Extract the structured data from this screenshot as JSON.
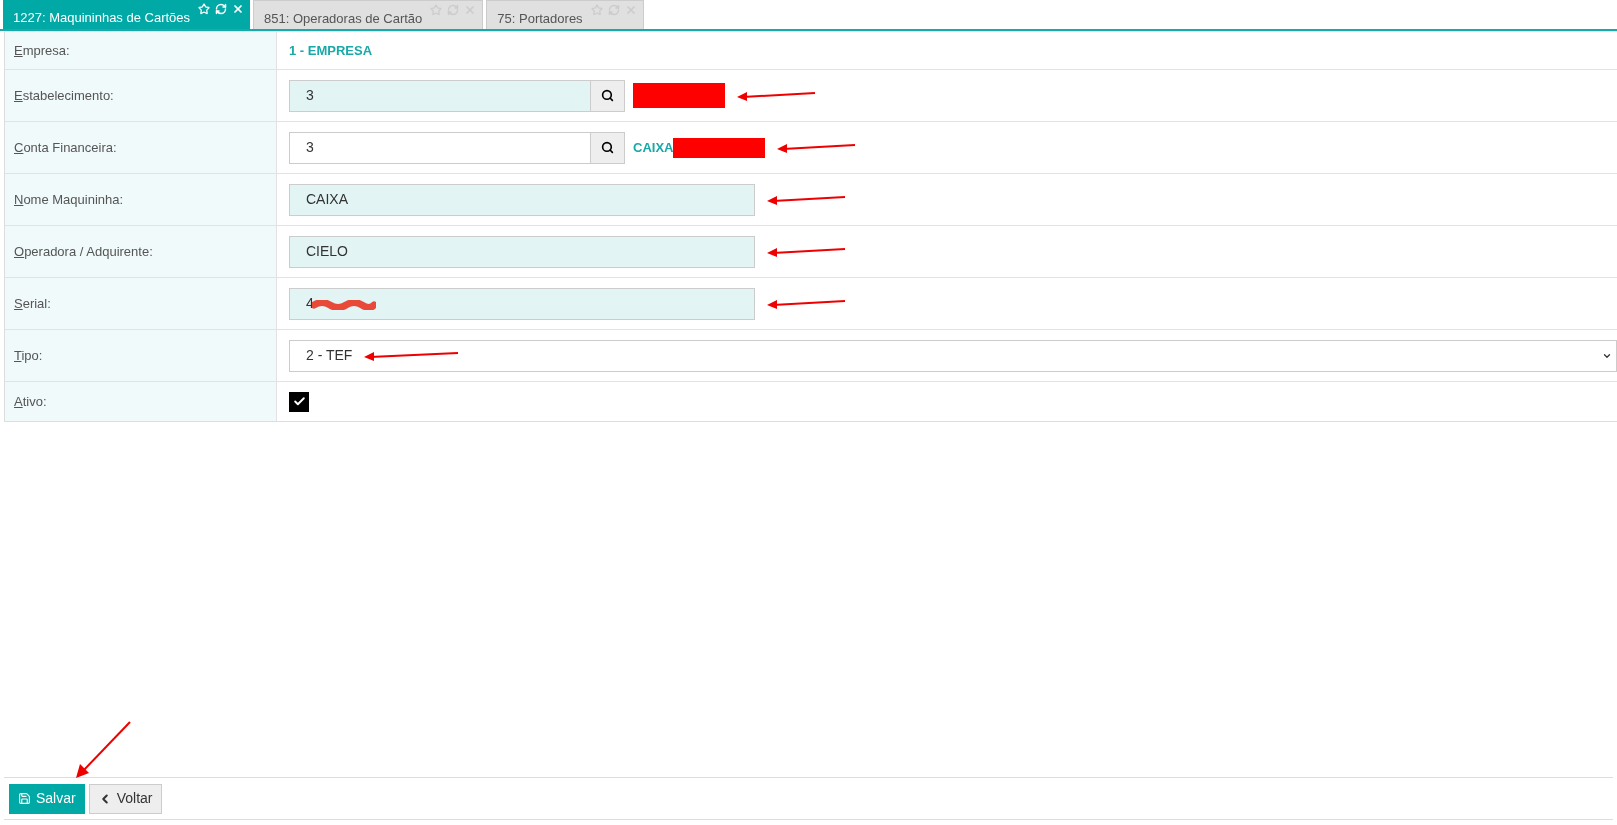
{
  "tabs": [
    {
      "label": "1227: Maquininhas de Cartões",
      "selected": true
    },
    {
      "label": "851: Operadoras de Cartão",
      "selected": false
    },
    {
      "label": "75: Portadores",
      "selected": false
    }
  ],
  "fields": [
    {
      "kind": "text",
      "label": "Empresa:",
      "value": "1 - EMPRESA",
      "arrow": false
    },
    {
      "kind": "lookup",
      "label": "Estabelecimento:",
      "value": "3",
      "readonly": true,
      "redacted": true,
      "arrow": true
    },
    {
      "kind": "lookup",
      "label": "Conta Financeira:",
      "value": "3",
      "readonly": false,
      "description": "CAIXA",
      "redacted": true,
      "arrow": true
    },
    {
      "kind": "input",
      "label": "Nome Maquininha:",
      "value": "CAIXA",
      "readonly": true,
      "arrow": true
    },
    {
      "kind": "input",
      "label": "Operadora / Adquirente:",
      "value": "CIELO",
      "readonly": true,
      "arrow": true
    },
    {
      "kind": "input",
      "label": "Serial:",
      "value": "4",
      "readonly": true,
      "redacted": true,
      "arrow": true
    },
    {
      "kind": "select",
      "label": "Tipo:",
      "value": "2 - TEF",
      "arrow": true
    },
    {
      "kind": "checkbox",
      "label": "Ativo:",
      "checked": true,
      "arrow": false
    }
  ],
  "buttons": [
    {
      "kind": "save",
      "label": "Salvar",
      "arrow": true
    },
    {
      "kind": "back",
      "label": "Voltar"
    }
  ]
}
